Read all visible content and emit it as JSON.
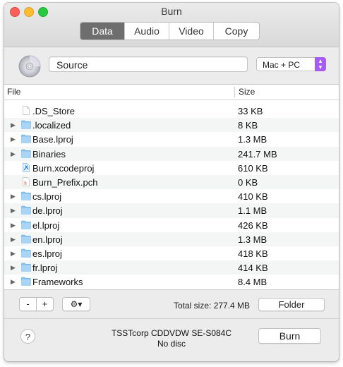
{
  "window": {
    "title": "Burn"
  },
  "tabs": [
    {
      "label": "Data",
      "active": true
    },
    {
      "label": "Audio",
      "active": false
    },
    {
      "label": "Video",
      "active": false
    },
    {
      "label": "Copy",
      "active": false
    }
  ],
  "source": {
    "value": "Source",
    "icon": "disc-icon"
  },
  "format": {
    "selected": "Mac + PC",
    "accent": "#a65ef0"
  },
  "table": {
    "headers": {
      "file": "File",
      "size": "Size"
    },
    "rows": [
      {
        "name": ".DS_Store",
        "size": "33 KB",
        "kind": "document",
        "expandable": false
      },
      {
        "name": ".localized",
        "size": "8 KB",
        "kind": "folder",
        "expandable": true
      },
      {
        "name": "Base.lproj",
        "size": "1.3 MB",
        "kind": "folder",
        "expandable": true
      },
      {
        "name": "Binaries",
        "size": "241.7 MB",
        "kind": "folder",
        "expandable": true
      },
      {
        "name": "Burn.xcodeproj",
        "size": "610 KB",
        "kind": "xcodeproj",
        "expandable": false
      },
      {
        "name": "Burn_Prefix.pch",
        "size": "0 KB",
        "kind": "header",
        "expandable": false
      },
      {
        "name": "cs.lproj",
        "size": "410 KB",
        "kind": "folder",
        "expandable": true
      },
      {
        "name": "de.lproj",
        "size": "1.1 MB",
        "kind": "folder",
        "expandable": true
      },
      {
        "name": "el.lproj",
        "size": "426 KB",
        "kind": "folder",
        "expandable": true
      },
      {
        "name": "en.lproj",
        "size": "1.3 MB",
        "kind": "folder",
        "expandable": true
      },
      {
        "name": "es.lproj",
        "size": "418 KB",
        "kind": "folder",
        "expandable": true
      },
      {
        "name": "fr.lproj",
        "size": "414 KB",
        "kind": "folder",
        "expandable": true
      },
      {
        "name": "Frameworks",
        "size": "8.4 MB",
        "kind": "folder",
        "expandable": true
      }
    ]
  },
  "toolbar": {
    "minus_label": "-",
    "plus_label": "+",
    "gear_label": "⚙▾",
    "total_size": "Total size: 277.4 MB",
    "folder_label": "Folder"
  },
  "footer": {
    "help_label": "?",
    "drive_name": "TSSTcorp CDDVDW SE-S084C",
    "disc_status": "No disc",
    "burn_label": "Burn"
  }
}
